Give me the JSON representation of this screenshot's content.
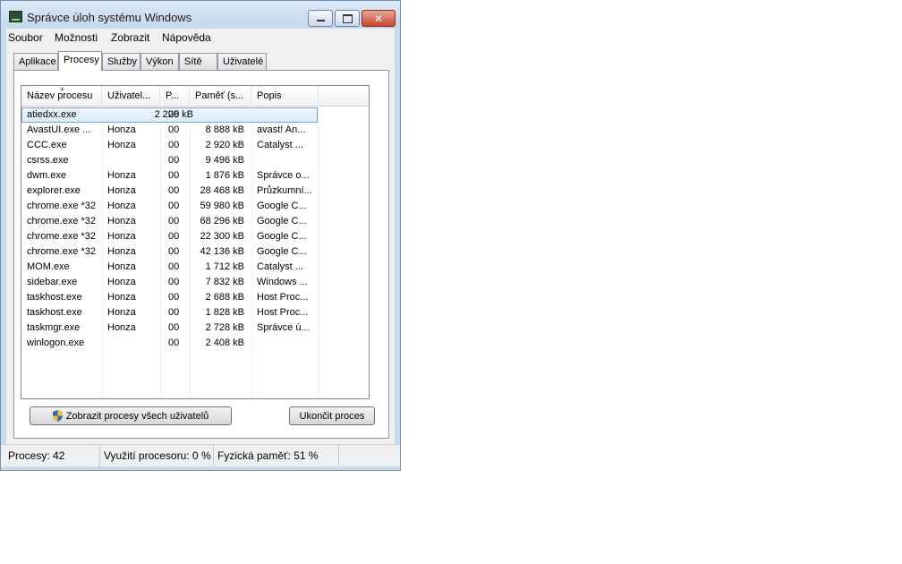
{
  "window": {
    "title": "Správce úloh systému Windows",
    "close_glyph": "✕"
  },
  "menu": [
    "Soubor",
    "Možnosti",
    "Zobrazit",
    "Nápověda"
  ],
  "tabs": [
    {
      "label": "Aplikace",
      "active": false
    },
    {
      "label": "Procesy",
      "active": true
    },
    {
      "label": "Služby",
      "active": false
    },
    {
      "label": "Výkon",
      "active": false
    },
    {
      "label": "Sítě",
      "active": false
    },
    {
      "label": "Uživatelé",
      "active": false
    }
  ],
  "columns": [
    "Název procesu",
    "Uživatel...",
    "P...",
    "Paměť (s...",
    "Popis"
  ],
  "sort_indicator": "▲",
  "rows": [
    {
      "name": "atiedxx.exe",
      "user": "",
      "cpu": "00",
      "mem": "2 228 kB",
      "desc": "",
      "selected": true
    },
    {
      "name": "AvastUI.exe ...",
      "user": "Honza",
      "cpu": "00",
      "mem": "8 888 kB",
      "desc": "avast! An..."
    },
    {
      "name": "CCC.exe",
      "user": "Honza",
      "cpu": "00",
      "mem": "2 920 kB",
      "desc": "Catalyst ..."
    },
    {
      "name": "csrss.exe",
      "user": "",
      "cpu": "00",
      "mem": "9 496 kB",
      "desc": ""
    },
    {
      "name": "dwm.exe",
      "user": "Honza",
      "cpu": "00",
      "mem": "1 876 kB",
      "desc": "Správce o..."
    },
    {
      "name": "explorer.exe",
      "user": "Honza",
      "cpu": "00",
      "mem": "28 468 kB",
      "desc": "Průzkumní..."
    },
    {
      "name": "chrome.exe *32",
      "user": "Honza",
      "cpu": "00",
      "mem": "59 980 kB",
      "desc": "Google C..."
    },
    {
      "name": "chrome.exe *32",
      "user": "Honza",
      "cpu": "00",
      "mem": "68 296 kB",
      "desc": "Google C..."
    },
    {
      "name": "chrome.exe *32",
      "user": "Honza",
      "cpu": "00",
      "mem": "22 300 kB",
      "desc": "Google C..."
    },
    {
      "name": "chrome.exe *32",
      "user": "Honza",
      "cpu": "00",
      "mem": "42 136 kB",
      "desc": "Google C..."
    },
    {
      "name": "MOM.exe",
      "user": "Honza",
      "cpu": "00",
      "mem": "1 712 kB",
      "desc": "Catalyst ..."
    },
    {
      "name": "sidebar.exe",
      "user": "Honza",
      "cpu": "00",
      "mem": "7 832 kB",
      "desc": "Windows ..."
    },
    {
      "name": "taskhost.exe",
      "user": "Honza",
      "cpu": "00",
      "mem": "2 688 kB",
      "desc": "Host Proc..."
    },
    {
      "name": "taskhost.exe",
      "user": "Honza",
      "cpu": "00",
      "mem": "1 828 kB",
      "desc": "Host Proc..."
    },
    {
      "name": "taskmgr.exe",
      "user": "Honza",
      "cpu": "00",
      "mem": "2 728 kB",
      "desc": "Správce ú..."
    },
    {
      "name": "winlogon.exe",
      "user": "",
      "cpu": "00",
      "mem": "2 408 kB",
      "desc": ""
    }
  ],
  "buttons": {
    "show_all": "Zobrazit procesy všech uživatelů",
    "end_process": "Ukončit proces"
  },
  "status": {
    "processes": "Procesy: 42",
    "cpu": "Využití procesoru: 0 %",
    "memory": "Fyzická paměť: 51 %"
  },
  "colors": {
    "selection": "#dcebfc",
    "frame": "#c9dcee",
    "close": "#c84530"
  }
}
